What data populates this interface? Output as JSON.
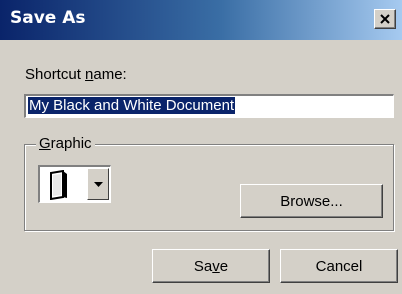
{
  "window": {
    "title": "Save As",
    "close_icon": "close-icon"
  },
  "form": {
    "shortcut_label_pre": "Shortcut ",
    "shortcut_label_accel": "n",
    "shortcut_label_post": "ame:",
    "shortcut_value": "My Black and White Document"
  },
  "graphic": {
    "legend_accel": "G",
    "legend_rest": "raphic",
    "selected_icon": "document-icon",
    "browse_label": "Browse..."
  },
  "buttons": {
    "save_pre": "Sa",
    "save_accel": "v",
    "save_post": "e",
    "cancel_label": "Cancel"
  }
}
